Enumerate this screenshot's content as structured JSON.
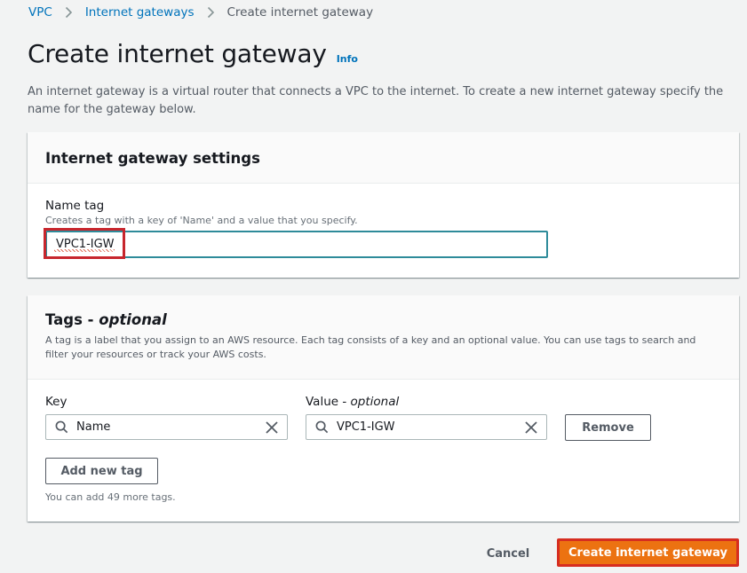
{
  "breadcrumb": {
    "items": [
      {
        "label": "VPC",
        "link": true
      },
      {
        "label": "Internet gateways",
        "link": true
      },
      {
        "label": "Create internet gateway",
        "link": false
      }
    ],
    "separator_icon": "chevron-right-icon"
  },
  "header": {
    "title": "Create internet gateway",
    "info_label": "Info",
    "description": "An internet gateway is a virtual router that connects a VPC to the internet. To create a new internet gateway specify the name for the gateway below."
  },
  "settings_panel": {
    "title": "Internet gateway settings",
    "name_tag": {
      "label": "Name tag",
      "description": "Creates a tag with a key of 'Name' and a value that you specify.",
      "value": "VPC1-IGW",
      "highlighted": true,
      "highlight_color": "#c7262d"
    }
  },
  "tags_panel": {
    "title": "Tags - ",
    "title_suffix": "optional",
    "description": "A tag is a label that you assign to an AWS resource. Each tag consists of a key and an optional value. You can use tags to search and filter your resources or track your AWS costs.",
    "key_label": "Key",
    "value_label": "Value - ",
    "value_label_suffix": "optional",
    "tags": [
      {
        "key": "Name",
        "value": "VPC1-IGW",
        "remove_label": "Remove"
      }
    ],
    "add_tag_label": "Add new tag",
    "hint": "You can add 49 more tags.",
    "icons": {
      "search": "search-icon",
      "clear": "close-icon"
    }
  },
  "footer": {
    "cancel_label": "Cancel",
    "create_label": "Create internet gateway",
    "create_color": "#ec7211",
    "create_highlight_color": "#d62d20"
  },
  "colors": {
    "link": "#0073bb",
    "focus_border": "#2e8b9a",
    "background": "#f2f3f3"
  }
}
